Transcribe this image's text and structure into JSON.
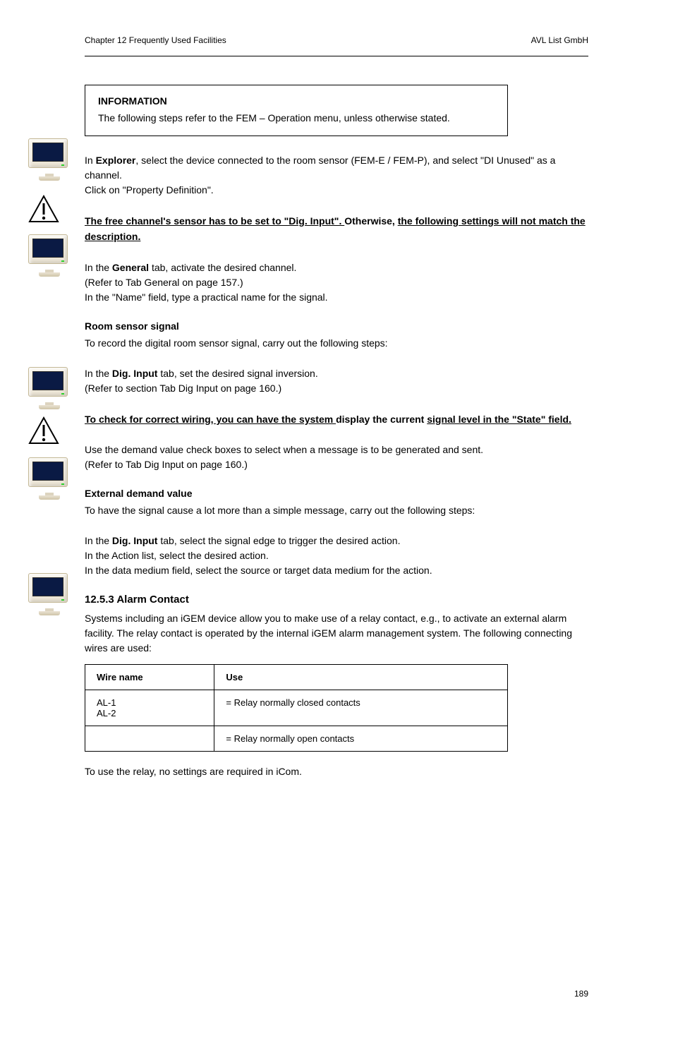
{
  "header": {
    "left": "Chapter 12 Frequently Used Facilities",
    "right": "AVL List GmbH"
  },
  "banner": {
    "title": "INFORMATION",
    "body": "The following steps refer to the FEM – Operation menu, unless otherwise stated."
  },
  "blocks": {
    "b1_line1_pre": "In ",
    "b1_line1_bold": "Explorer",
    "b1_line1_post": ", select the device connected to the room sensor (FEM-E / FEM-P), and select \"DI Unused\" as a channel.",
    "b1_line2": "Click on \"Property Definition\".",
    "w1_full": "The free channel's sensor has to be set to \"Dig. Input\". Otherwise, the following settings will not match the description.",
    "w1_u1": "Otherwise, ",
    "w1_u2": "the following settings will not match the description.",
    "b2_line1_pre": "In the ",
    "b2_line1_bold": "General",
    "b2_line1_post": " tab, activate the desired channel.",
    "b2_line2": "(Refer to Tab General on page 157.)",
    "b2_line3": "In the \"Name\" field, type a practical name for the signal.",
    "section_room_sensor": "Room sensor signal",
    "b3_intro": "To record the digital room sensor signal, carry out the following steps:",
    "b4_line1_pre": "In the ",
    "b4_line1_bold": "Dig. Input",
    "b4_line1_post": " tab, set the desired signal inversion.",
    "b4_line2": "(Refer to section Tab Dig Input on page 160.)",
    "w2_full": "To check for correct wiring, you can have the system display the current signal level in the \"State\" field.",
    "w2_u1": "display the current ",
    "w2_u2": "signal level in the \"State\" field.",
    "b5_line1": "Use the demand value check boxes to select when a message is to be generated and sent.",
    "b5_line2": "(Refer to Tab Dig Input on page 160.)",
    "section_ext_demand": "External demand value",
    "b6_intro": "To have the signal cause a lot more than a simple message, carry out the following steps:",
    "b7_line1_pre": "In the ",
    "b7_line1_bold": "Dig. Input",
    "b7_line1_post": " tab, select the signal edge to trigger the desired action.",
    "b7_line2": "In the Action list, select the desired action.",
    "b7_line3": "In the data medium field, select the source or target data medium for the action.",
    "section_12_5_3": "12.5.3 Alarm Contact",
    "alarm_para": "Systems including an iGEM device allow you to make use of a relay contact, e.g., to activate an external alarm facility. The relay contact is operated by the internal iGEM alarm management system. The following connecting wires are used:",
    "table": {
      "h1": "Wire name",
      "h2": "Use",
      "r1c1": "AL-1",
      "r1c2": "= Relay normally closed contacts",
      "r2c1": "AL-2",
      "r2c2": "",
      "r3c1": "",
      "r3c2": "= Relay normally open contacts"
    },
    "note": "To use the relay, no settings are required in iCom."
  },
  "pagenum": "189"
}
